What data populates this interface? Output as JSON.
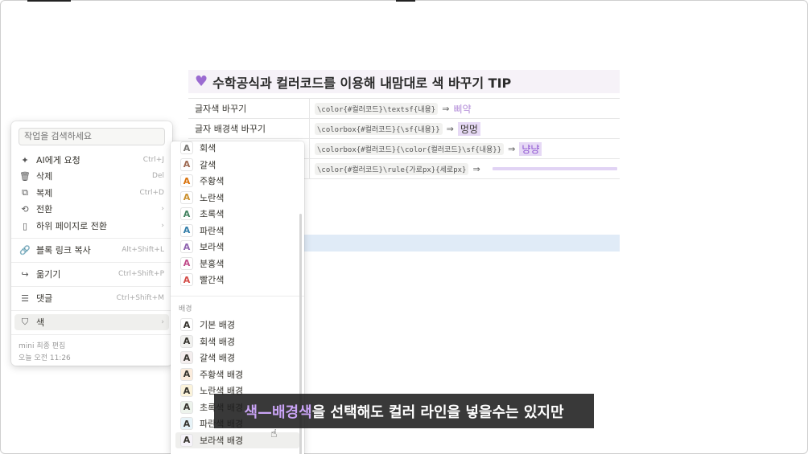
{
  "page": {
    "heading": "수학공식과 컬러코드를 이용해 내맘대로 색 바꾸기 TIP",
    "heart_icon": "purple-heart-icon",
    "table": [
      {
        "label": "글자색 바꾸기",
        "code": "\\color{#컬러코드}\\textsf{내용}",
        "arrow": "⇒",
        "result": "삐약"
      },
      {
        "label": "글자 배경색 바꾸기",
        "code": "\\colorbox{#컬러코드}{\\sf{내용}}",
        "arrow": "⇒",
        "result": "멍멍"
      },
      {
        "label": "",
        "code": "\\colorbox{#컬러코드}{\\color{컬러코드}\\sf{내용}}",
        "arrow": "⇒",
        "result": "냥냥"
      },
      {
        "label": "",
        "code": "\\color{#컬러코드}\\rule{가로px}{세로px}",
        "arrow": "⇒",
        "result": ""
      }
    ]
  },
  "menu": {
    "search_placeholder": "작업을 검색하세요",
    "items": [
      {
        "icon": "sparkle-icon",
        "glyph": "✦",
        "label": "AI에게 요청",
        "shortcut": "Ctrl+J"
      },
      {
        "icon": "trash-icon",
        "glyph": "🗑",
        "label": "삭제",
        "shortcut": "Del"
      },
      {
        "icon": "copy-icon",
        "glyph": "⧉",
        "label": "복제",
        "shortcut": "Ctrl+D"
      },
      {
        "icon": "turn-into-icon",
        "glyph": "⟲",
        "label": "전환",
        "shortcut": "›"
      },
      {
        "icon": "page-icon",
        "glyph": "▯",
        "label": "하위 페이지로 전환",
        "shortcut": "›"
      },
      {
        "icon": "link-icon",
        "glyph": "🔗",
        "label": "블록 링크 복사",
        "shortcut": "Alt+Shift+L"
      },
      {
        "icon": "move-icon",
        "glyph": "↪",
        "label": "옮기기",
        "shortcut": "Ctrl+Shift+P"
      },
      {
        "icon": "comment-icon",
        "glyph": "☰",
        "label": "댓글",
        "shortcut": "Ctrl+Shift+M"
      },
      {
        "icon": "paint-icon",
        "glyph": "⛉",
        "label": "색",
        "shortcut": "›"
      }
    ],
    "meta_editor": "mini 최종 편집",
    "meta_time": "오늘 오전 11:26"
  },
  "color_submenu": {
    "text_colors": [
      {
        "label": "회색",
        "color": "#787774"
      },
      {
        "label": "갈색",
        "color": "#9f6b53"
      },
      {
        "label": "주황색",
        "color": "#d9730d"
      },
      {
        "label": "노란색",
        "color": "#cb912f"
      },
      {
        "label": "초록색",
        "color": "#448361"
      },
      {
        "label": "파란색",
        "color": "#337ea9"
      },
      {
        "label": "보라색",
        "color": "#9065b0"
      },
      {
        "label": "분홍색",
        "color": "#c14c8a"
      },
      {
        "label": "빨간색",
        "color": "#d44c47"
      }
    ],
    "background_header": "배경",
    "backgrounds": [
      {
        "label": "기본 배경",
        "bg": "#ffffff"
      },
      {
        "label": "회색 배경",
        "bg": "#f1f1ef"
      },
      {
        "label": "갈색 배경",
        "bg": "#f4eeee"
      },
      {
        "label": "주황색 배경",
        "bg": "#fbecdd"
      },
      {
        "label": "노란색 배경",
        "bg": "#fbf3db"
      },
      {
        "label": "초록색 배경",
        "bg": "#edf3ec"
      },
      {
        "label": "파란색 배경",
        "bg": "#e7f3f8"
      },
      {
        "label": "보라색 배경",
        "bg": "#f6f3f9"
      }
    ],
    "swatch_letter": "A"
  },
  "caption": {
    "highlight": "색—배경색",
    "rest": "을 선택해도 컬러 라인을 넣을수는 있지만"
  }
}
